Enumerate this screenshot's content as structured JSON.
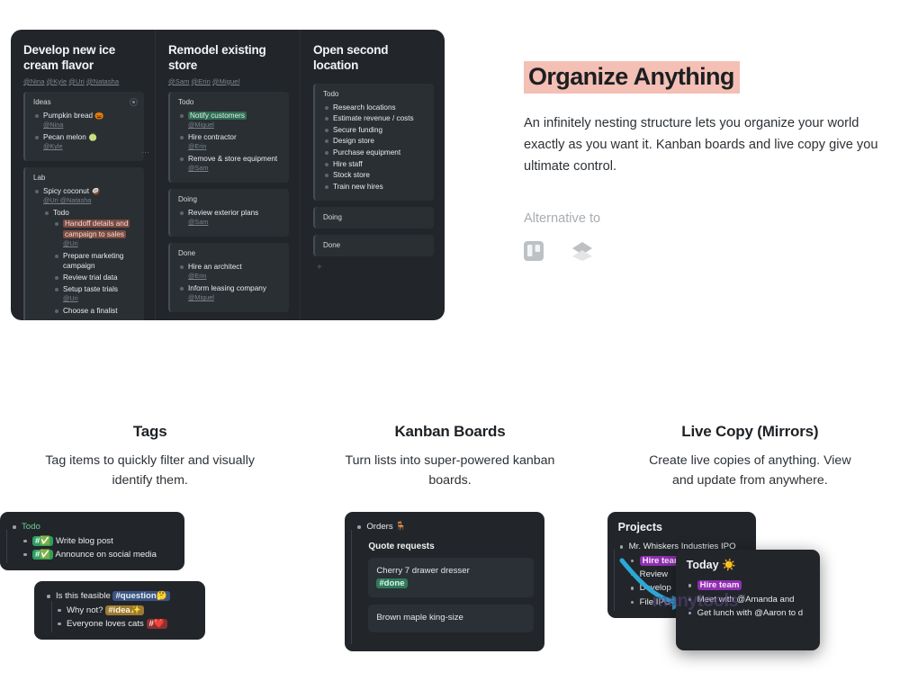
{
  "hero": {
    "title": "Organize Anything",
    "title_highlight_color": "#f4bfb4",
    "body": "An infinitely nesting structure lets you organize your world exactly as you want it. Kanban boards and live copy give you ultimate control.",
    "alternative_label": "Alternative to",
    "logos": [
      {
        "name": "trello-logo",
        "label": "Trello"
      },
      {
        "name": "layers-logo",
        "label": "Layers"
      }
    ]
  },
  "board": {
    "columns": [
      {
        "title": "Develop new ice cream flavor",
        "mentions": [
          "@Nina",
          "@Kyle",
          "@Uri",
          "@Natasha"
        ],
        "cards": [
          {
            "title": "Ideas",
            "has_collapse_icon": true,
            "items": [
              {
                "text": "Pumpkin bread 🎃",
                "mention": "@Nina"
              },
              {
                "text": "Pecan melon 🍈",
                "mention": "@Kyle"
              }
            ]
          },
          {
            "title": "Lab",
            "items": [
              {
                "text": "Spicy coconut 🥥",
                "mention": "@Uri @Natasha"
              }
            ],
            "nested_title": "Todo",
            "nested_items": [
              {
                "text": "Handoff details and campaign to sales",
                "mention": "@Uri",
                "highlight": "brown"
              },
              {
                "text": "Prepare marketing campaign",
                "mention": ""
              },
              {
                "text": "Review trial data",
                "mention": ""
              },
              {
                "text": "Setup taste trials",
                "mention": "@Uri"
              },
              {
                "text": "Choose a finalist",
                "mention": ""
              }
            ]
          }
        ]
      },
      {
        "title": "Remodel existing store",
        "mentions": [
          "@Sam",
          "@Erin",
          "@Miguel"
        ],
        "cards": [
          {
            "title": "Todo",
            "items": [
              {
                "text": "Notify customers",
                "mention": "@Miguel",
                "highlight": "green"
              },
              {
                "text": "Hire contractor",
                "mention": "@Erin"
              },
              {
                "text": "Remove & store equipment",
                "mention": "@Sam"
              }
            ]
          },
          {
            "title": "Doing",
            "items": [
              {
                "text": "Review exterior plans",
                "mention": "@Sam"
              }
            ]
          },
          {
            "title": "Done",
            "items": [
              {
                "text": "Hire an architect",
                "mention": "@Erin"
              },
              {
                "text": "Inform leasing company",
                "mention": "@Miguel"
              }
            ]
          }
        ]
      },
      {
        "title": "Open second location",
        "mentions": [],
        "cards": [
          {
            "title": "Todo",
            "items": [
              {
                "text": "Research locations",
                "mention": ""
              },
              {
                "text": "Estimate revenue / costs",
                "mention": ""
              },
              {
                "text": "Secure funding",
                "mention": ""
              },
              {
                "text": "Design store",
                "mention": ""
              },
              {
                "text": "Purchase equipment",
                "mention": ""
              },
              {
                "text": "Hire staff",
                "mention": ""
              },
              {
                "text": "Stock store",
                "mention": ""
              },
              {
                "text": "Train new hires",
                "mention": ""
              }
            ]
          },
          {
            "title": "Doing",
            "items": []
          },
          {
            "title": "Done",
            "items": []
          }
        ],
        "add_label": "+"
      }
    ]
  },
  "features": [
    {
      "title": "Tags",
      "desc": "Tag items to quickly filter and visually identify them.",
      "tags_shot": {
        "panel_a": {
          "header": "Todo",
          "items": [
            {
              "tag": "#✅",
              "tag_style": "green",
              "text": "Write blog post"
            },
            {
              "tag": "#✅",
              "tag_style": "green",
              "text": "Announce on social media"
            }
          ]
        },
        "panel_b": {
          "line1_text": "Is this feasible ",
          "line1_tag": "#question🤔",
          "line2_text": "Why not? ",
          "line2_tag": "#idea✨",
          "line3_text": "Everyone loves cats ",
          "line3_tag": "#❤️"
        }
      }
    },
    {
      "title": "Kanban Boards",
      "desc": "Turn lists into super-powered kanban boards.",
      "kanban_shot": {
        "root": "Orders 🪑",
        "section": "Quote requests",
        "cards": [
          {
            "text": "Cherry 7 drawer dresser",
            "tag": "#done"
          },
          {
            "text": "Brown maple king-size",
            "tag": ""
          }
        ]
      }
    },
    {
      "title": "Live Copy (Mirrors)",
      "desc": "Create live copies of anything. View and update from anywhere.",
      "mirror_shot": {
        "back_panel": {
          "header": "Projects",
          "root": "Mr. Whiskers Industries IPO",
          "items": [
            {
              "text": "Hire team",
              "highlight": "purple"
            },
            {
              "text": "Review",
              "highlight": ""
            },
            {
              "text": "Develop",
              "highlight": ""
            },
            {
              "text": "File IPO",
              "highlight": ""
            }
          ]
        },
        "front_panel": {
          "header": "Today ☀️",
          "items": [
            {
              "text": "Hire team",
              "highlight": "purple"
            },
            {
              "text": "Meet with @Amanda and",
              "highlight": ""
            },
            {
              "text": "Get lunch with @Aaron to d",
              "highlight": ""
            }
          ]
        },
        "arrow_color": "#2ca8d8",
        "watermark": "manytools"
      }
    }
  ]
}
